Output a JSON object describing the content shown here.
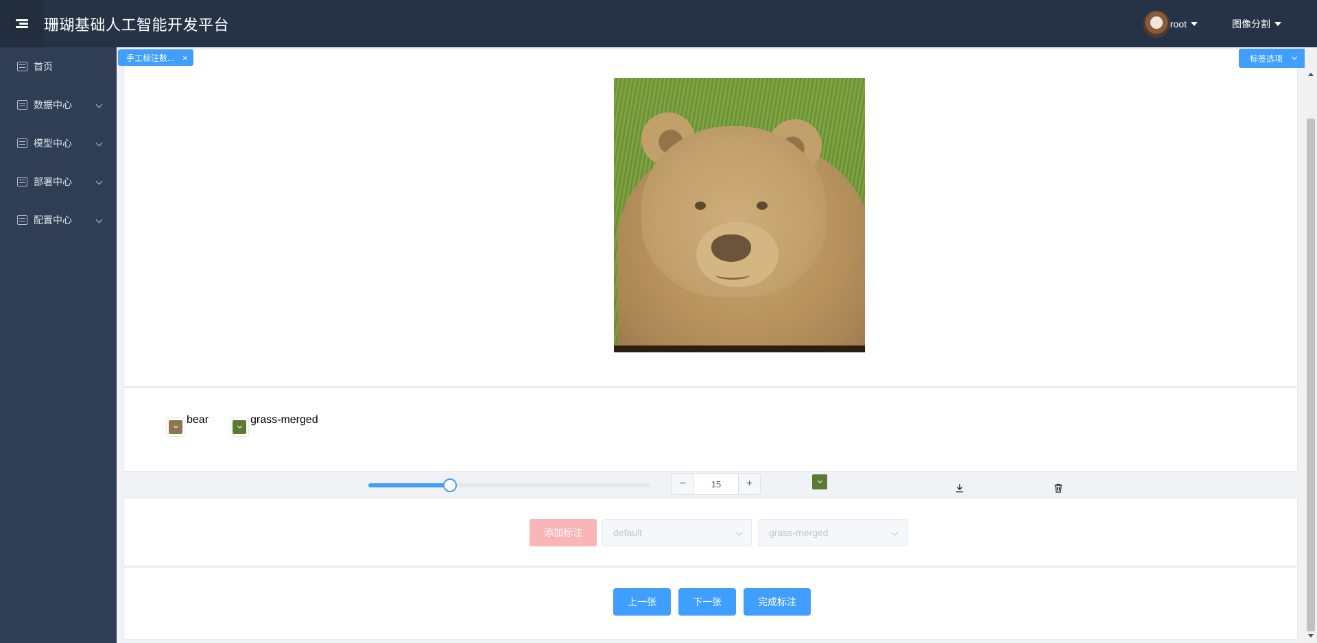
{
  "header": {
    "app_title": "珊瑚基础人工智能开发平台",
    "user_name": "root",
    "mode_label": "图像分割"
  },
  "sidebar": {
    "items": [
      {
        "label": "首页",
        "expandable": false
      },
      {
        "label": "数据中心",
        "expandable": true
      },
      {
        "label": "模型中心",
        "expandable": true
      },
      {
        "label": "部署中心",
        "expandable": true
      },
      {
        "label": "配置中心",
        "expandable": true
      }
    ]
  },
  "tabs": {
    "active_tab_label": "手工标注数...",
    "close_symbol": "×",
    "label_options_button": "标签选项"
  },
  "legend": {
    "items": [
      {
        "label": "bear",
        "color": "#8f7651"
      },
      {
        "label": "grass-merged",
        "color": "#5b7a36"
      }
    ]
  },
  "tools": {
    "brush_size_slider_fraction": 0.29,
    "brush_size_value": "15",
    "minus_symbol": "−",
    "plus_symbol": "+",
    "current_color": "#5b7a36",
    "download_icon": "download-icon",
    "delete_icon": "trash-icon"
  },
  "annotation": {
    "add_button_label": "添加标注",
    "select_a_placeholder": "default",
    "select_b_placeholder": "grass-merged"
  },
  "navigation": {
    "prev_label": "上一张",
    "next_label": "下一张",
    "finish_label": "完成标注"
  },
  "colors": {
    "primary": "#409eff",
    "header_bg": "#263347",
    "sidebar_bg": "#2f3e55",
    "disabled_danger": "#fab6b6"
  }
}
